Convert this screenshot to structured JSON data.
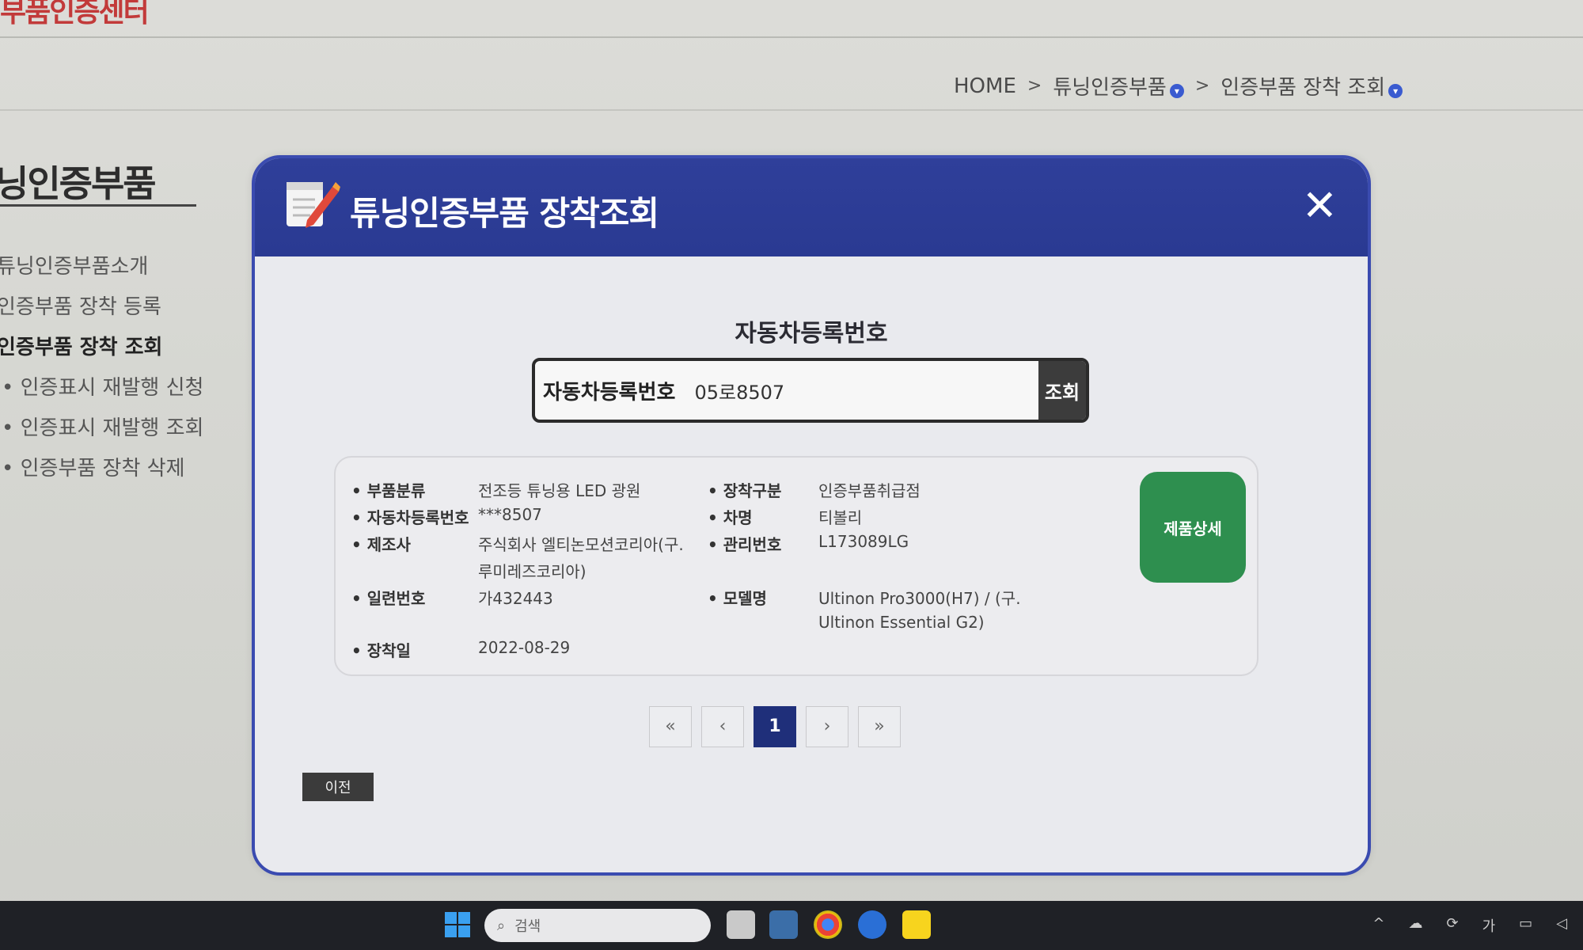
{
  "header": {
    "logo_text": "부품인증센터",
    "breadcrumb": [
      "HOME",
      "튜닝인증부품",
      "인증부품 장착 조회"
    ],
    "breadcrumb_sep": ">"
  },
  "sidebar": {
    "title": "닝인증부품",
    "items": [
      {
        "label": "튜닝인증부품소개"
      },
      {
        "label": "인증부품 장착 등록"
      },
      {
        "label": "인증부품 장착 조회"
      },
      {
        "label": "• 인증표시 재발행 신청"
      },
      {
        "label": "• 인증표시 재발행 조회"
      },
      {
        "label": "• 인증부품 장착 삭제"
      }
    ]
  },
  "modal": {
    "title": "튜닝인증부품 장착조회",
    "close_label": "✕",
    "search_heading": "자동차등록번호",
    "search_label": "자동차등록번호",
    "search_value": "05로8507",
    "search_button": "조회",
    "result": {
      "part_category_label": "부품분류",
      "part_category": "전조등 튜닝용 LED 광원",
      "reg_no_label": "자동차등록번호",
      "reg_no": "***8507",
      "maker_label": "제조사",
      "maker": "주식회사 엘티논모션코리아(구.",
      "maker_line2": "루미레즈코리아)",
      "serial_label": "일련번호",
      "serial": "가432443",
      "install_date_label": "장착일",
      "install_date": "2022-08-29",
      "install_type_label": "장착구분",
      "install_type": "인증부품취급점",
      "car_name_label": "차명",
      "car_name": "티볼리",
      "mgmt_no_label": "관리번호",
      "mgmt_no": "L173089LG",
      "model_label": "모델명",
      "model": "Ultinon Pro3000(H7) / (구.",
      "model_line2": "Ultinon Essential G2)",
      "detail_button": "제품상세"
    },
    "pager": {
      "first": "«",
      "prev": "‹",
      "current": "1",
      "next": "›",
      "last": "»"
    },
    "prev_button": "이전"
  },
  "taskbar": {
    "search_placeholder": "검색",
    "tray_lang": "가"
  }
}
